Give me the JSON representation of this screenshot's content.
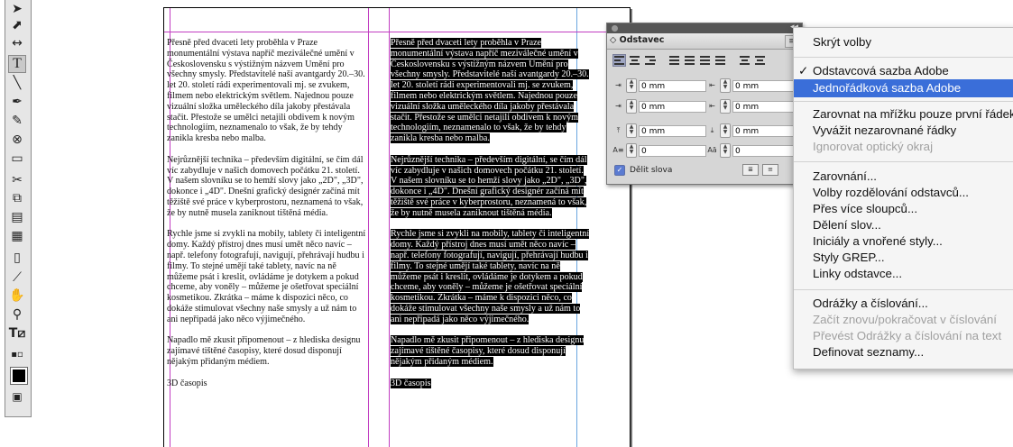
{
  "tools": [
    "selection-tool",
    "direct-selection-tool",
    "gap-tool",
    "type-tool",
    "line-tool",
    "pen-tool",
    "pencil-tool",
    "ellipse-frame-tool",
    "rectangle-tool",
    "scissors-tool",
    "free-transform-tool",
    "gradient-swatch-tool",
    "gradient-feather-tool",
    "note-tool",
    "eyedropper-tool",
    "hand-tool",
    "zoom-tool",
    "fill-stroke",
    "apply-color",
    "fill-swatch",
    "view-mode"
  ],
  "document": {
    "paragraphs": [
      "Přesně před dvaceti lety proběhla v Praze monumentální výstava napříč meziválečné umění v Československu s výstižným názvem Umění pro všechny smysly. Představitelé naší avantgardy 20.–30. let 20. století rádi experimentovali mj. se zvukem, filmem nebo elektrickým světlem. Najednou pouze vizuální složka uměleckého díla jakoby přestávala stačit. Přestože se umělci netajili obdivem k novým technologiím, neznamenalo to však, že by tehdy zanikla kresba nebo malba.",
      "Nejrůznější technika – především digitální, se čím dál víc zabydluje v našich domovech počátku 21. století. V našem slovníku se to hemží slovy jako „2D\", „3D\", dokonce i „4D\". Dnešní grafický designér začíná mít těžiště své práce v kyberprostoru, neznamená to však, že by nutně musela zaniknout tištěná média.",
      "Rychle jsme si zvykli na mobily, tablety či inteligentní domy. Každý přístroj dnes musí umět něco navíc – např. telefony fotografují, navigují, přehrávají hudbu i filmy. To stejné umějí také tablety, navíc na ně můžeme psát i kreslit, ovládáme je dotykem a pokud chceme, aby voněly – můžeme je ošetřovat speciální kosmetikou. Zkrátka – máme k dispozici něco, co dokáže stimulovat všechny naše smysly a už nám to ani nepřipadá jako něco výjimečného.",
      "Napadlo mě zkusit připomenout – z hlediska designu zajímavé tištěné časopisy, které dosud disponují nějakým přidaným médiem."
    ],
    "subhead": "3D časopis"
  },
  "paragraph_panel": {
    "tab_label": "Odstavec",
    "left_indent": "0 mm",
    "right_indent": "0 mm",
    "first_line_indent": "0 mm",
    "last_line_indent": "0 mm",
    "space_before": "0 mm",
    "space_after": "0 mm",
    "drop_cap_lines": "0",
    "drop_cap_chars": "0",
    "hyphenate_label": "Dělit slova"
  },
  "menu": {
    "items": [
      {
        "label": "Skrýt volby",
        "state": "normal"
      },
      {
        "label": "Odstavcová sazba Adobe",
        "state": "checked"
      },
      {
        "label": "Jednořádková sazba Adobe",
        "state": "highlight"
      },
      {
        "label": "Zarovnat na mřížku pouze první řádek",
        "state": "normal"
      },
      {
        "label": "Vyvážit nezarovnané řádky",
        "state": "normal"
      },
      {
        "label": "Ignorovat optický okraj",
        "state": "disabled"
      },
      {
        "label": "Zarovnání...",
        "state": "normal"
      },
      {
        "label": "Volby rozdělování odstavců...",
        "state": "normal"
      },
      {
        "label": "Přes více sloupců...",
        "state": "normal"
      },
      {
        "label": "Dělení slov...",
        "state": "normal"
      },
      {
        "label": "Iniciály a vnořené styly...",
        "state": "normal"
      },
      {
        "label": "Styly GREP...",
        "state": "normal"
      },
      {
        "label": "Linky odstavce...",
        "state": "normal"
      },
      {
        "label": "Odrážky a číslování...",
        "state": "normal"
      },
      {
        "label": "Začít znovu/pokračovat v číslování",
        "state": "disabled"
      },
      {
        "label": "Převést Odrážky a číslování na text",
        "state": "disabled"
      },
      {
        "label": "Definovat seznamy...",
        "state": "normal"
      }
    ],
    "check_mark": "✓"
  },
  "colors": {
    "highlight": "#3a6ed9",
    "guide": "#c13cc1",
    "selection": "#000000"
  }
}
